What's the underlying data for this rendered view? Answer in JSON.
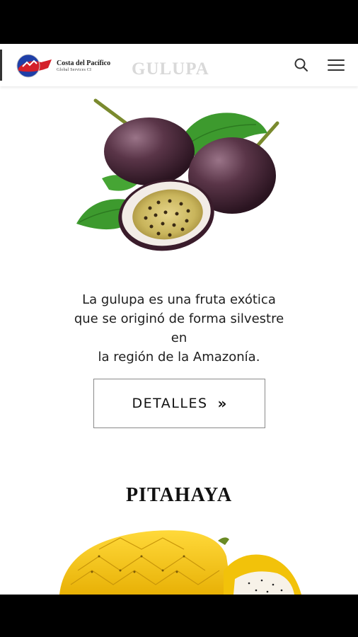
{
  "header": {
    "brand_name": "Costa del Pacífico",
    "brand_subtitle": "Global Services CI",
    "ghost_title": "GULUPA",
    "search_icon": "search-icon",
    "menu_icon": "hamburger-menu-icon"
  },
  "products": [
    {
      "name": "GULUPA",
      "image_icon": "passion-fruit-image",
      "description_lines": [
        "La gulupa es una fruta exótica",
        "que se originó de forma silvestre",
        "en",
        "la región de la Amazonía."
      ],
      "button_label": "DETALLES",
      "button_icon": "double-chevron-right-icon"
    },
    {
      "name": "PITAHAYA",
      "image_icon": "dragon-fruit-image"
    }
  ],
  "colors": {
    "accent_red": "#d4202a",
    "accent_blue": "#1f3fa8",
    "fruit_purple": "#4a2a3d",
    "leaf_green": "#3d9a2e",
    "pitahaya_yellow": "#f2c20a"
  }
}
